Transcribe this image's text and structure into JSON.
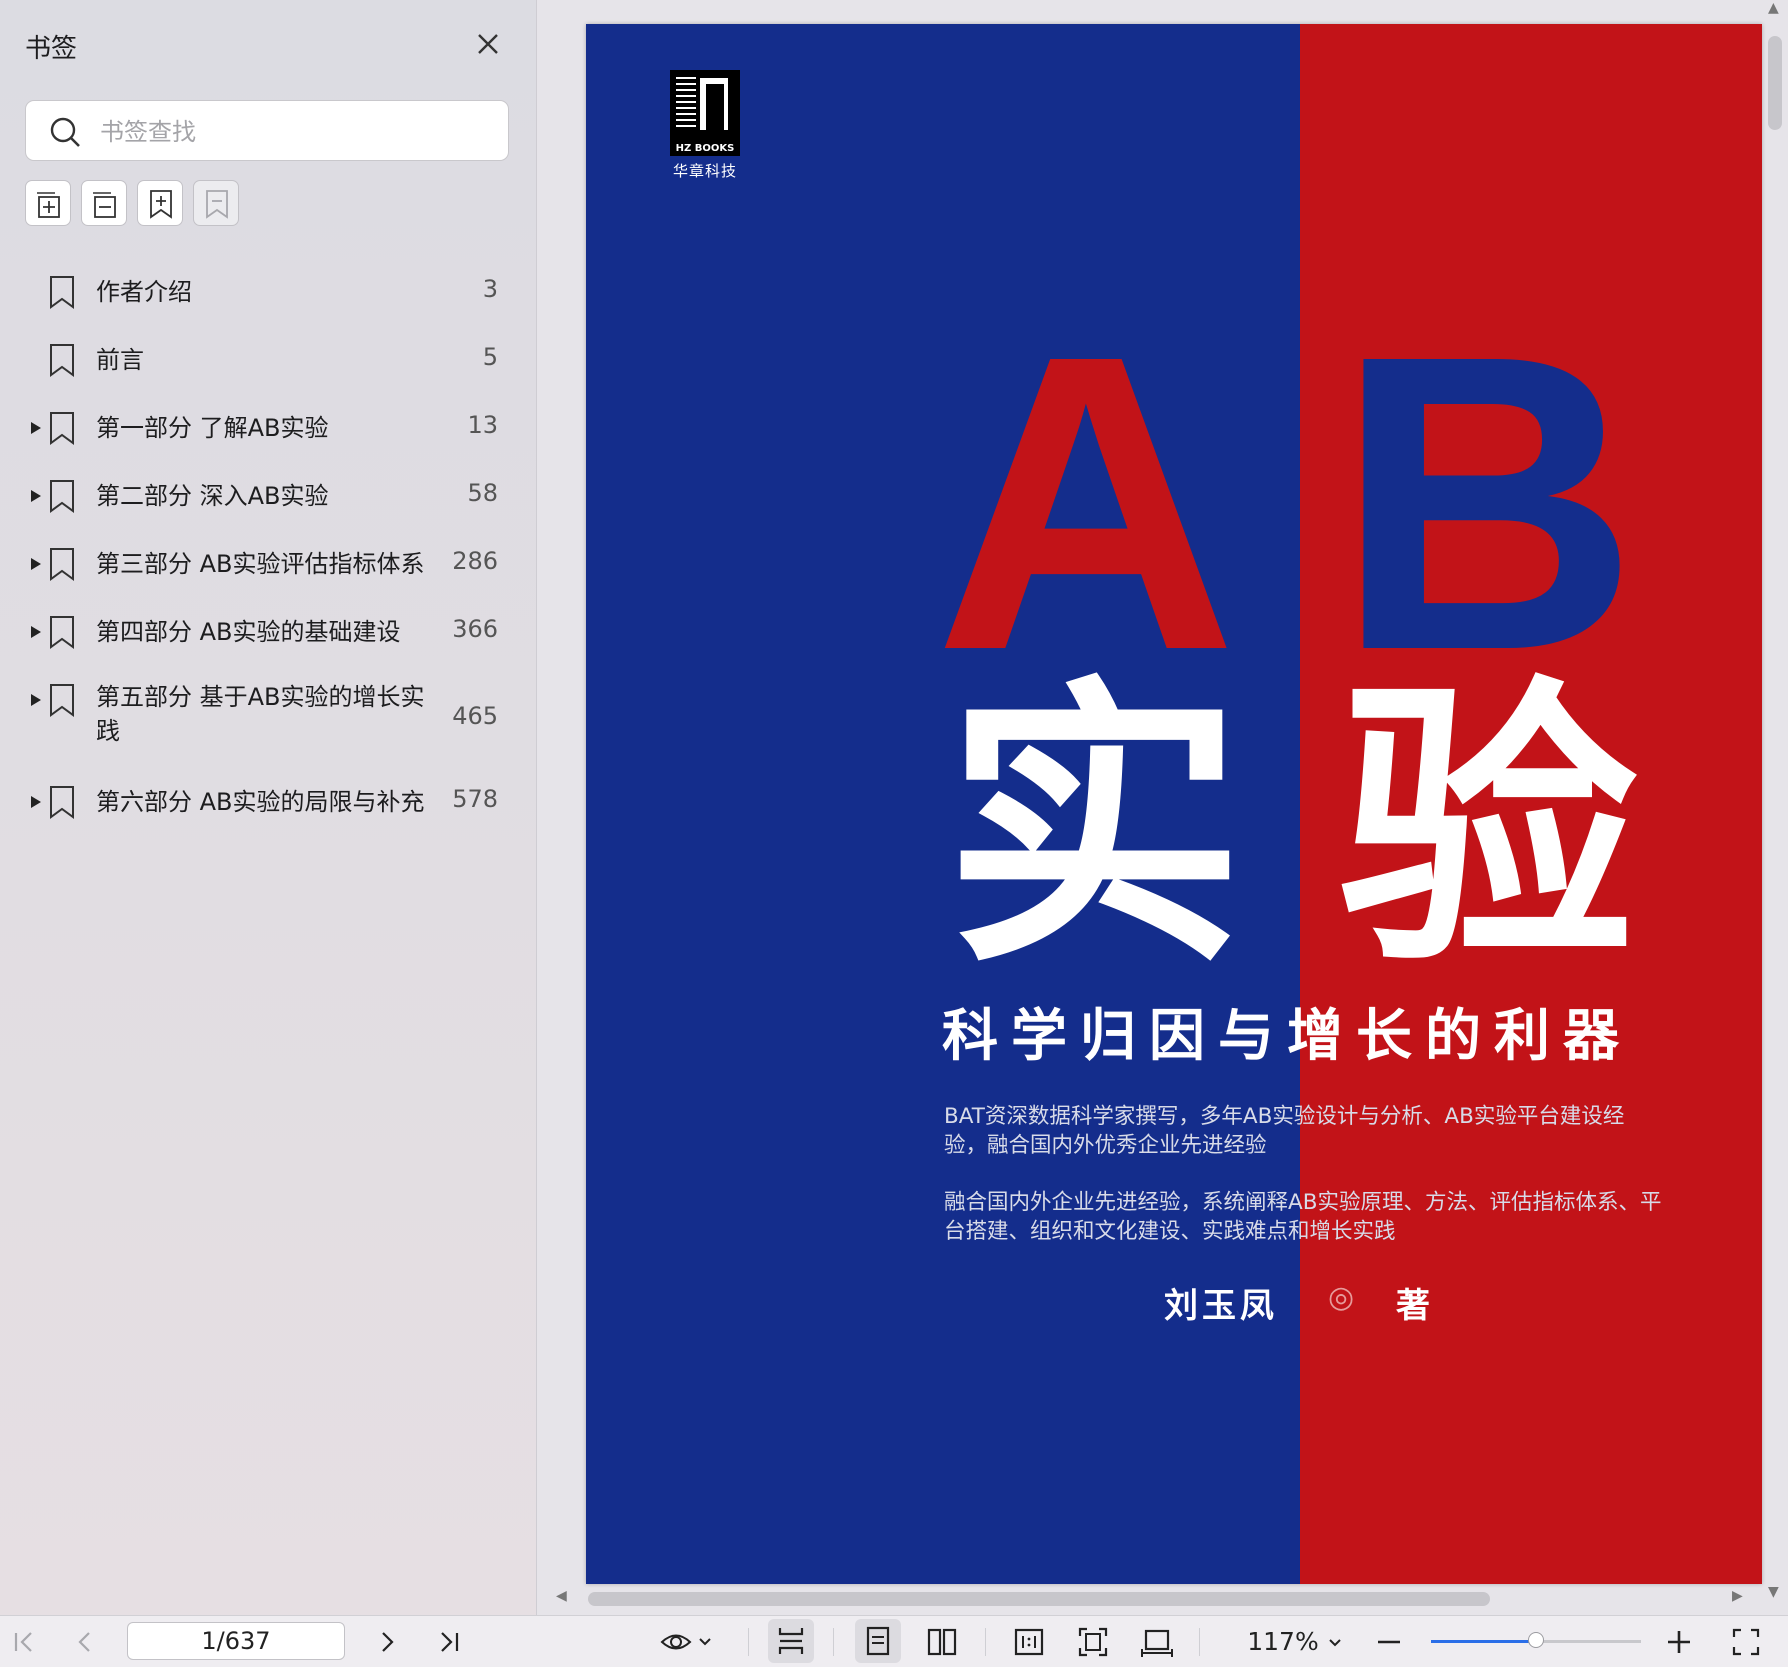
{
  "sidebar": {
    "title": "书签",
    "search_placeholder": "书签查找",
    "bookmarks": [
      {
        "label": "作者介绍",
        "page": "3",
        "expandable": false
      },
      {
        "label": "前言",
        "page": "5",
        "expandable": false
      },
      {
        "label": "第一部分 了解AB实验",
        "page": "13",
        "expandable": true
      },
      {
        "label": "第二部分 深入AB实验",
        "page": "58",
        "expandable": true
      },
      {
        "label": "第三部分 AB实验评估指标体系",
        "page": "286",
        "expandable": true
      },
      {
        "label": "第四部分 AB实验的基础建设",
        "page": "366",
        "expandable": true
      },
      {
        "label": "第五部分 基于AB实验的增长实践",
        "page": "465",
        "expandable": true
      },
      {
        "label": "第六部分 AB实验的局限与补充",
        "page": "578",
        "expandable": true
      }
    ]
  },
  "cover": {
    "publisher_logo_text": "HZ BOOKS",
    "publisher_name": "华章科技",
    "title_letter_a": "A",
    "title_letter_b": "B",
    "title_char_1": "实",
    "title_char_2": "验",
    "subtitle": "科学归因与增长的利器",
    "blurb_1": "BAT资深数据科学家撰写，多年AB实验设计与分析、AB实验平台建设经验，融合国内外优秀企业先进经验",
    "blurb_2": "融合国内外企业先进经验，系统阐释AB实验原理、方法、评估指标体系、平台搭建、组织和文化建设、实践难点和增长实践",
    "author": "刘玉凤",
    "author_mark": "◎",
    "author_role": "著"
  },
  "bottombar": {
    "page_indicator": "1/637",
    "zoom": "117%",
    "zoom_level": 0.5
  },
  "colors": {
    "cover_blue": "#142d8c",
    "cover_red": "#c21318",
    "accent": "#2a6ee8"
  }
}
